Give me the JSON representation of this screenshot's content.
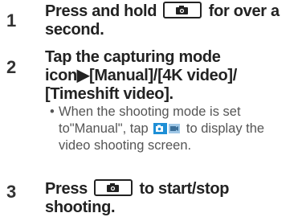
{
  "steps": [
    {
      "number": "1",
      "before_key": "Press and hold ",
      "key_icon": "camera-icon",
      "after_key": " for over a second."
    },
    {
      "number": "2",
      "title_line1": "Tap the capturing mode",
      "title_line2": "icon▶[Manual]/[4K video]/",
      "title_line3": "[Timeshift video].",
      "bullet_mark": "•",
      "note_part1": "When the shooting mode is set to\"Manual\", tap ",
      "note_icon": "video-mode-icon",
      "note_part2": " to display the video shooting screen."
    },
    {
      "number": "3",
      "before_key": "Press ",
      "key_icon": "camera-icon",
      "after_key": " to start/stop shooting."
    }
  ],
  "colors": {
    "icon_blue": "#1e8fd6",
    "text_dark": "#222222",
    "text_gray": "#555555"
  }
}
